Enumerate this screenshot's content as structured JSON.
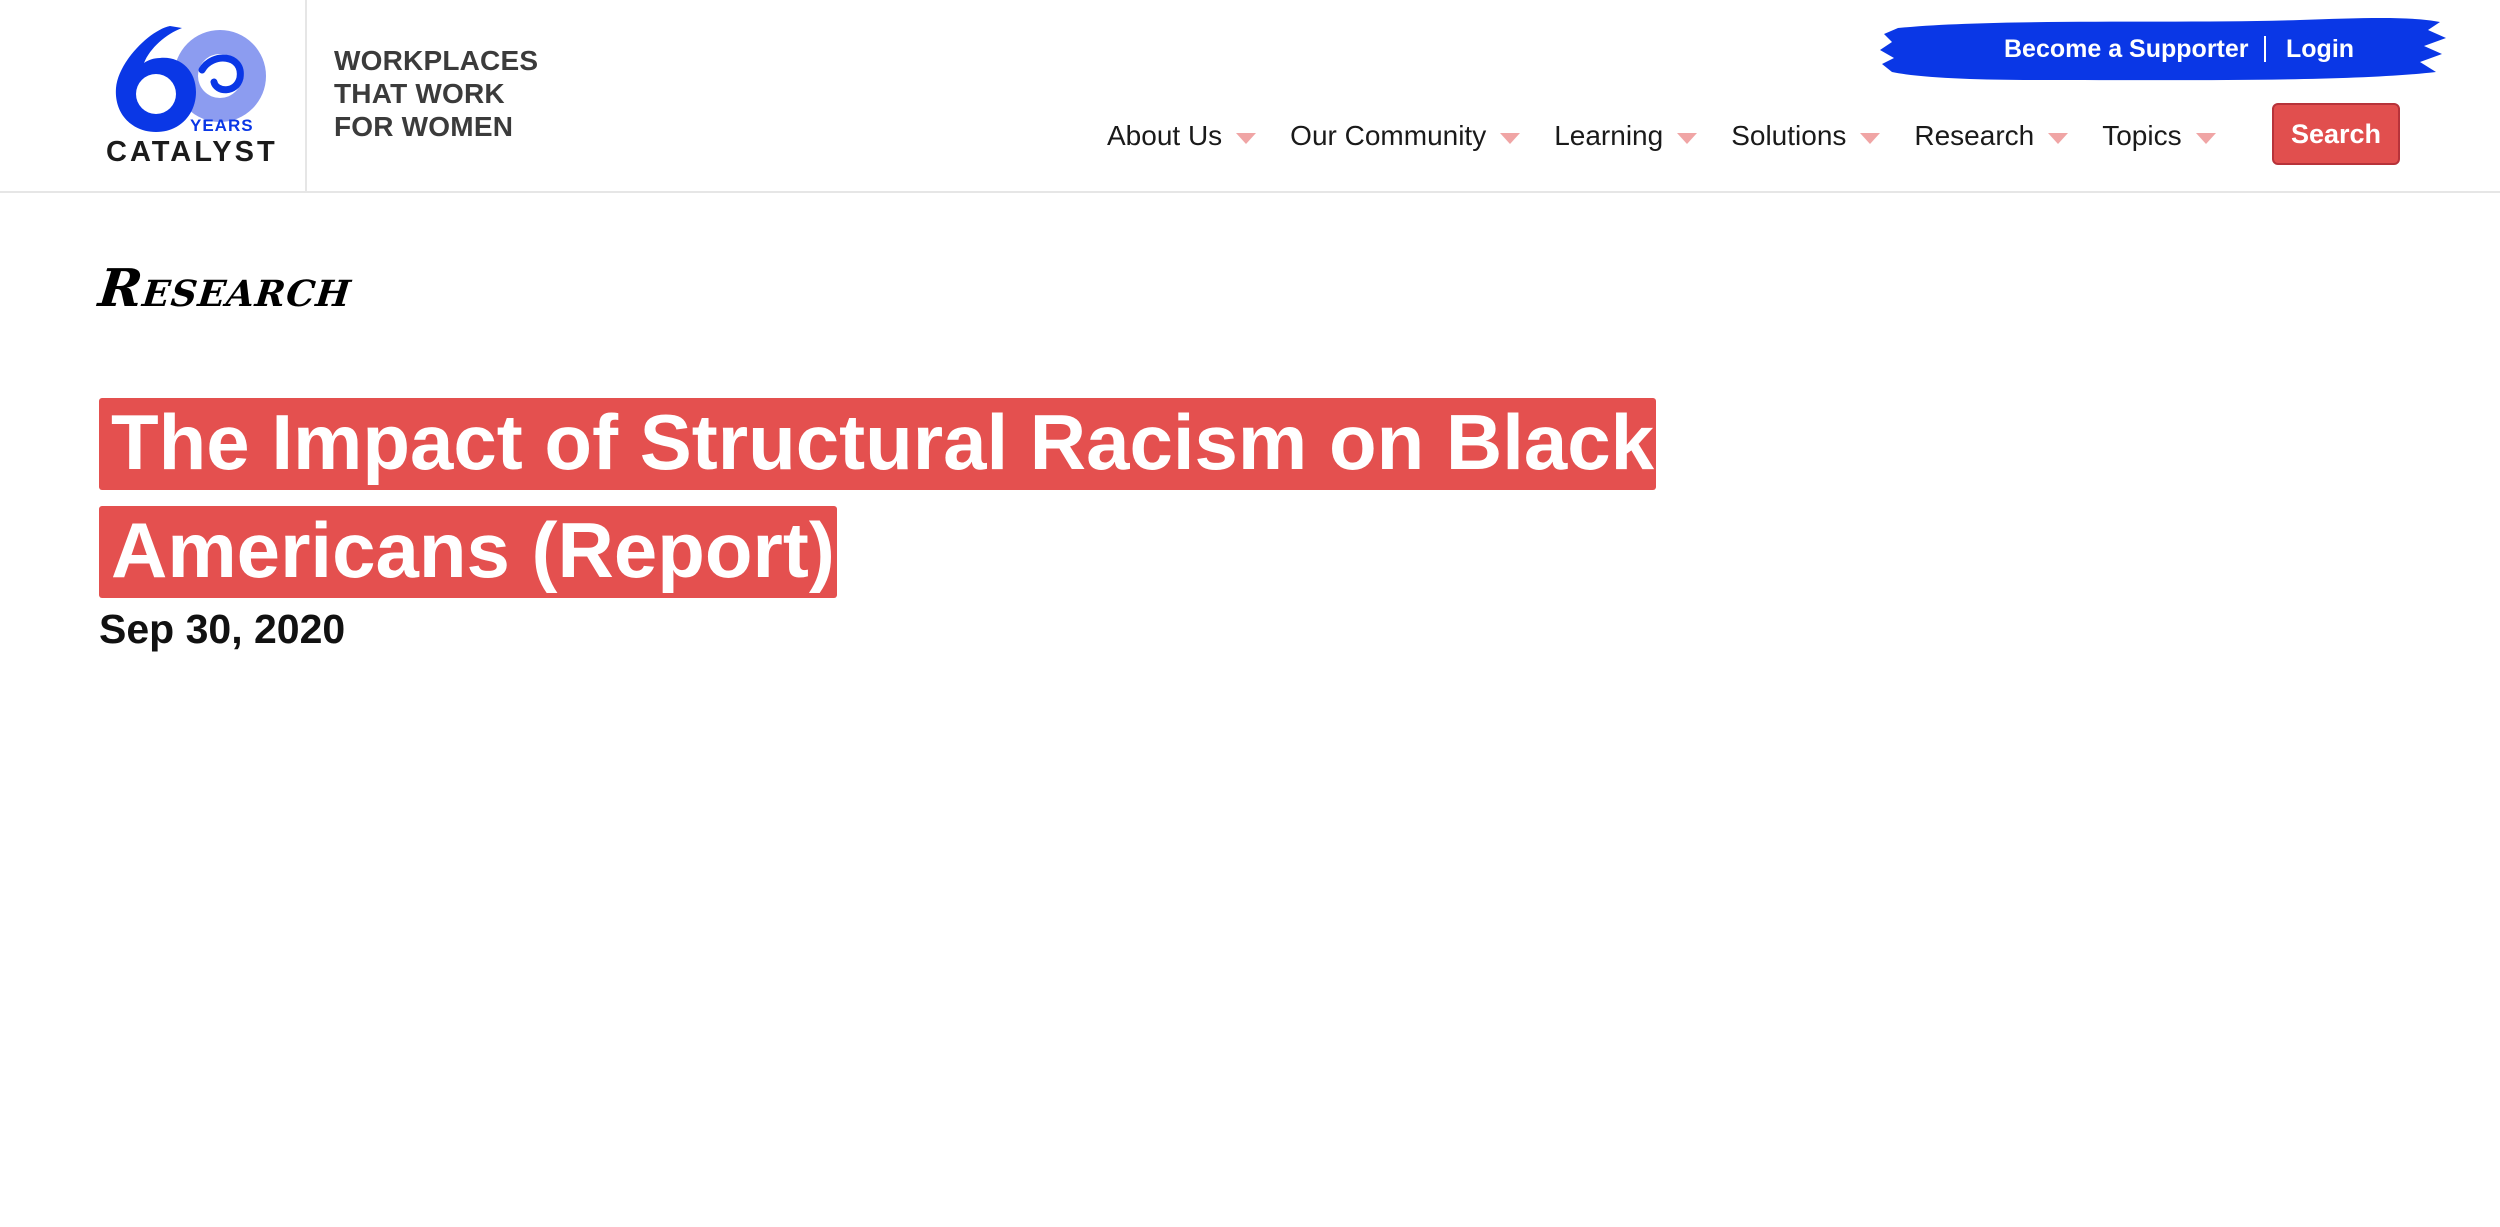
{
  "header": {
    "logo": {
      "numeral": "60",
      "years_label": "YEARS",
      "name": "CATALYST"
    },
    "tagline": [
      "WORKPLACES",
      "THAT WORK",
      "FOR WOMEN"
    ],
    "supporter_bar": {
      "become_label": "Become a Supporter",
      "login_label": "Login",
      "color": "#0a37e6"
    },
    "nav": {
      "items": [
        {
          "label": "About Us"
        },
        {
          "label": "Our Community"
        },
        {
          "label": "Learning"
        },
        {
          "label": "Solutions"
        },
        {
          "label": "Research"
        },
        {
          "label": "Topics"
        }
      ],
      "search_label": "Search",
      "caret_color": "#f0a5a5"
    }
  },
  "main": {
    "section_label": "Research",
    "title": "The Impact of Structural Racism on Black Americans (Report)",
    "date": "Sep 30, 2020",
    "highlight_color": "#e4504f"
  }
}
